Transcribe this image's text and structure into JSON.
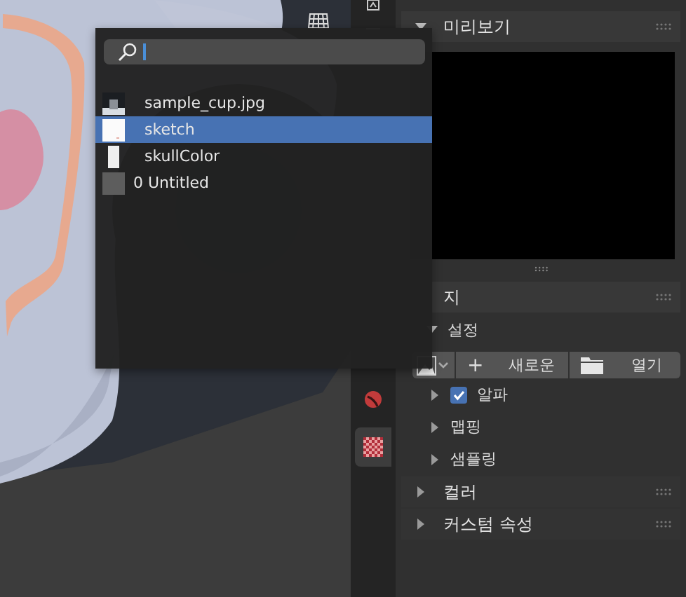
{
  "image_browser": {
    "items": [
      {
        "name": "sample_cup.jpg",
        "selected": false
      },
      {
        "name": "sketch",
        "kind": "blank",
        "selected": true
      },
      {
        "name": "skullColor",
        "kind": "narrow",
        "selected": false
      },
      {
        "name": "0 Untitled",
        "kind": "empty",
        "selected": false
      }
    ]
  },
  "property_tabs": [
    {
      "kind": "material",
      "selected": false
    },
    {
      "kind": "texture",
      "selected": true
    }
  ],
  "preview": {
    "title": "미리보기",
    "expanded": true
  },
  "image_section": {
    "title": "지",
    "expanded": true,
    "settings": {
      "title": "설정",
      "expanded": true
    },
    "new_button": {
      "icon_text": "+",
      "label": "새로운"
    },
    "open_button": {
      "label": "열기"
    },
    "rows": [
      {
        "kind": "checkbox",
        "label": "알파",
        "checked": true,
        "expanded": false
      },
      {
        "kind": "panel",
        "label": "맵핑",
        "expanded": false
      },
      {
        "kind": "panel",
        "label": "샘플링",
        "expanded": false
      }
    ]
  },
  "sections": [
    {
      "title": "컬러",
      "expanded": false
    },
    {
      "title": "커스텀 속성",
      "expanded": false
    }
  ]
}
